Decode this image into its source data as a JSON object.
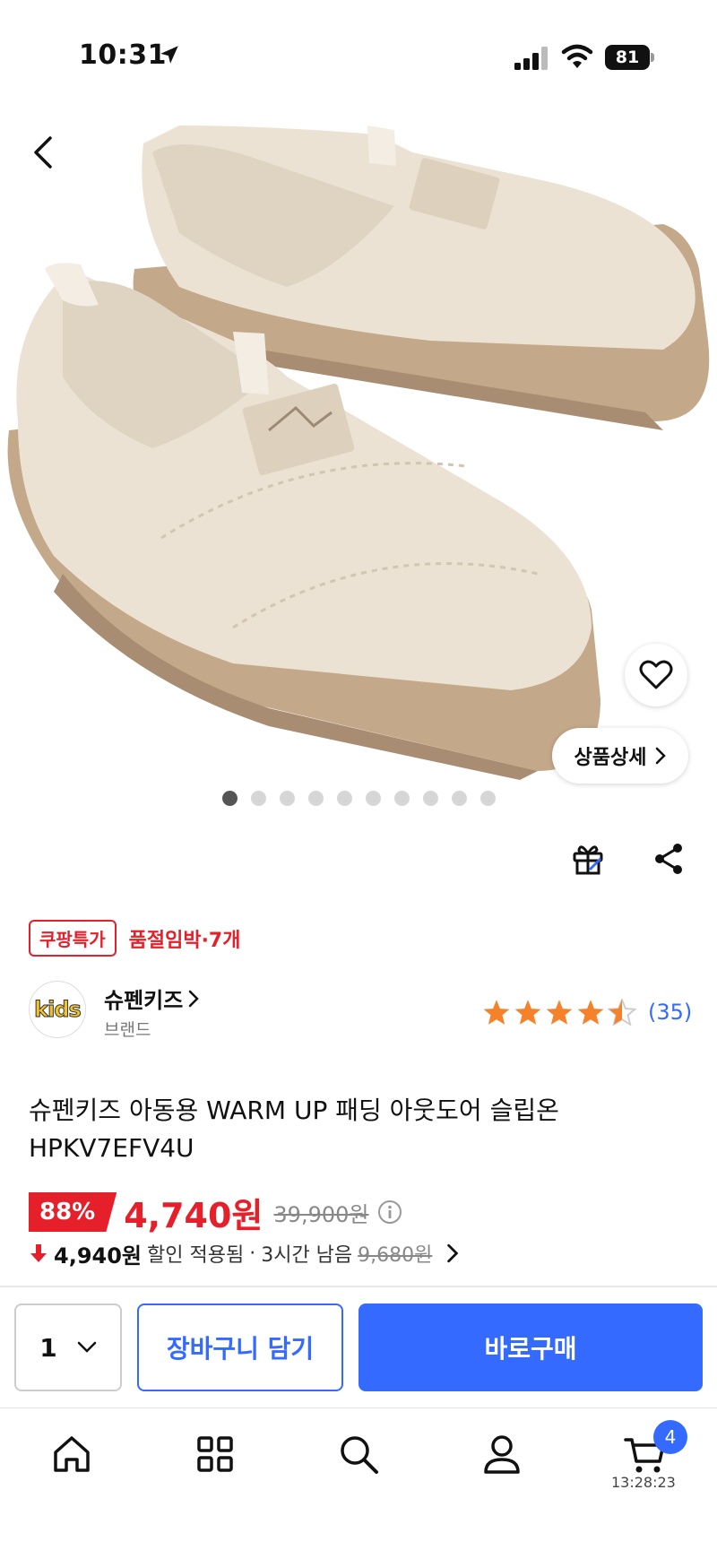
{
  "status": {
    "time": "10:31",
    "battery": "81"
  },
  "hero": {
    "image_alt": "beige quilted kids slip-on shoes",
    "detail_label": "상품상세",
    "dots_total": 10,
    "dots_active": 0
  },
  "badges": {
    "deal": "쿠팡특가",
    "stock": "품절임박·7개"
  },
  "brand": {
    "logo_text": "kids",
    "name": "슈펜키즈",
    "sub": "브랜드"
  },
  "rating": {
    "stars": 4.5,
    "count": "(35)"
  },
  "product": {
    "title": "슈펜키즈 아동용 WARM UP 패딩 아웃도어 슬립온 HPKV7EFV4U"
  },
  "price": {
    "discount": "88%",
    "sale": "4,740원",
    "original": "39,900원",
    "coupon_amount": "4,940원",
    "coupon_text": "할인 적용됨",
    "separator": "·",
    "remaining": "3시간 남음",
    "coupon_original": "9,680원"
  },
  "purchase": {
    "qty": "1",
    "cart_label": "장바구니 담기",
    "buy_label": "바로구매"
  },
  "tabbar": {
    "cart_badge": "4",
    "clock": "13:28:23"
  },
  "colors": {
    "accent": "#346aff",
    "sale_red": "#e5202a",
    "star": "#f5822b"
  }
}
